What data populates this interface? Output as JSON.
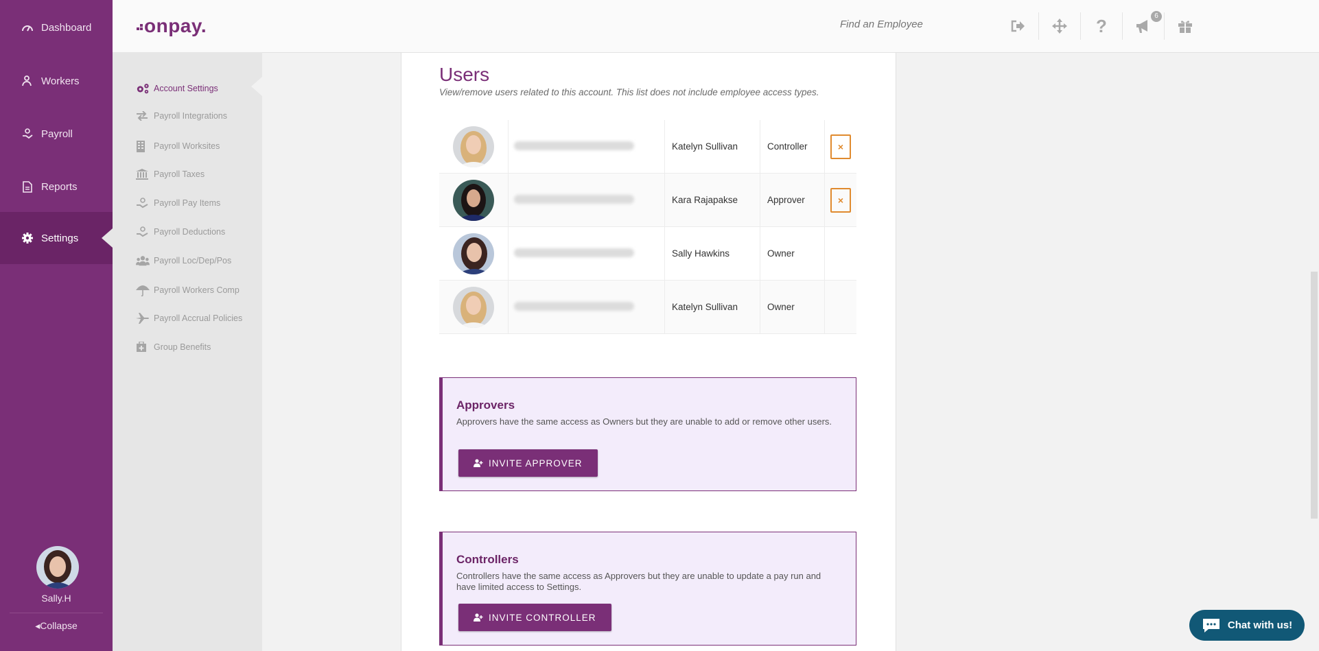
{
  "sidebar": {
    "items": [
      {
        "label": "Dashboard",
        "icon": "dashboard-gauge-icon"
      },
      {
        "label": "Workers",
        "icon": "worker-icon"
      },
      {
        "label": "Payroll",
        "icon": "payroll-hand-icon"
      },
      {
        "label": "Reports",
        "icon": "report-icon"
      },
      {
        "label": "Settings",
        "icon": "gear-icon",
        "active": true
      }
    ],
    "user_name": "Sally.H",
    "collapse_label": "Collapse"
  },
  "topbar": {
    "logo": "onpay.",
    "search_placeholder": "Find an Employee",
    "notification_count": "6"
  },
  "subnav": {
    "items": [
      {
        "label": "Account Settings",
        "icon": "gears-icon",
        "active": true
      },
      {
        "label": "Payroll Integrations",
        "icon": "exchange-icon"
      },
      {
        "label": "Payroll Worksites",
        "icon": "building-icon"
      },
      {
        "label": "Payroll Taxes",
        "icon": "bank-icon"
      },
      {
        "label": "Payroll Pay Items",
        "icon": "hand-money-icon"
      },
      {
        "label": "Payroll Deductions",
        "icon": "hand-money-icon"
      },
      {
        "label": "Payroll Loc/Dep/Pos",
        "icon": "users-icon"
      },
      {
        "label": "Payroll Workers Comp",
        "icon": "umbrella-icon"
      },
      {
        "label": "Payroll Accrual Policies",
        "icon": "plane-icon"
      },
      {
        "label": "Group Benefits",
        "icon": "medkit-icon"
      }
    ]
  },
  "users": {
    "title": "Users",
    "subtitle": "View/remove users related to this account. This list does not include employee access types.",
    "rows": [
      {
        "name": "Katelyn Sullivan",
        "role": "Controller",
        "removable": true
      },
      {
        "name": "Kara Rajapakse",
        "role": "Approver",
        "removable": true
      },
      {
        "name": "Sally Hawkins",
        "role": "Owner",
        "removable": false
      },
      {
        "name": "Katelyn Sullivan",
        "role": "Owner",
        "removable": false
      }
    ],
    "remove_symbol": "×"
  },
  "approvers": {
    "title": "Approvers",
    "description": "Approvers have the same access as Owners but they are unable to add or remove other users.",
    "button_label": "INVITE APPROVER"
  },
  "controllers": {
    "title": "Controllers",
    "description": "Controllers have the same access as Approvers but they are unable to update a pay run and have limited access to Settings.",
    "button_label": "INVITE CONTROLLER"
  },
  "chat": {
    "label": "Chat with us!"
  },
  "colors": {
    "brand": "#7a2f77",
    "remove": "#e08a2e",
    "chat": "#115876"
  }
}
